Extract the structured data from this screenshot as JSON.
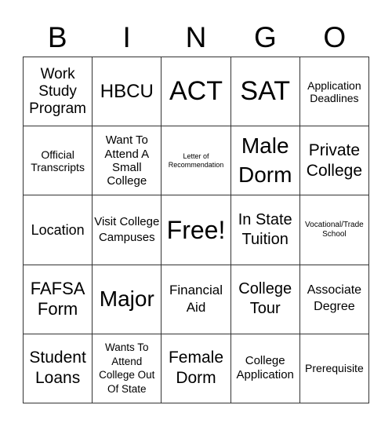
{
  "header": {
    "letters": [
      "B",
      "I",
      "N",
      "G",
      "O"
    ]
  },
  "board": {
    "cells": [
      "Work Study Program",
      "HBCU",
      "ACT",
      "SAT",
      "Application Deadlines",
      "Official Transcripts",
      "Want To Attend A Small College",
      "Letter of Recommendation",
      "Male Dorm",
      "Private College",
      "Location",
      "Visit College Campuses",
      "Free!",
      "In State Tuition",
      "Vocational/Trade School",
      "FAFSA Form",
      "Major",
      "Financial Aid",
      "College Tour",
      "Associate Degree",
      "Student Loans",
      "Wants To Attend College Out Of State",
      "Female Dorm",
      "College Application",
      "Prerequisite"
    ],
    "free_space": "Free!",
    "border_color": "#333333"
  }
}
